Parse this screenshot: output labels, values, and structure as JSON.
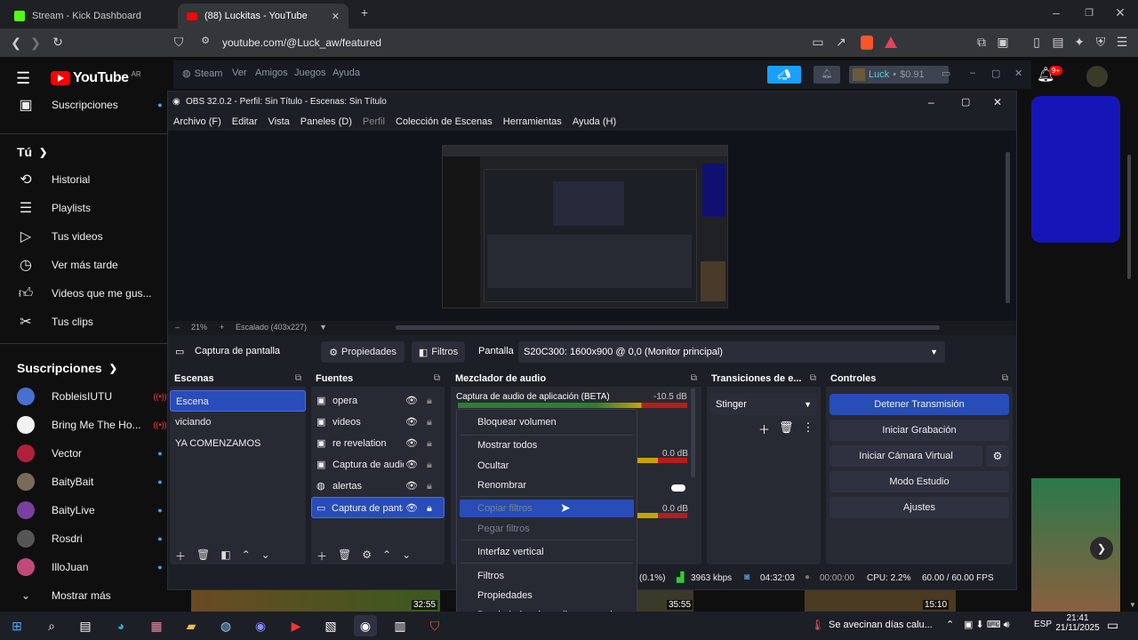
{
  "browser": {
    "tabs": [
      {
        "title": "Stream - Kick Dashboard"
      },
      {
        "title": "(88) Luckitas - YouTube"
      }
    ],
    "url": "youtube.com/@Luck_aw/featured"
  },
  "youtube": {
    "logo": "YouTube",
    "region": "AR",
    "subscriptions_label": "Suscripciones",
    "you_label": "Tú",
    "you_items": [
      "Historial",
      "Playlists",
      "Tus videos",
      "Ver más tarde",
      "Videos que me gus...",
      "Tus clips"
    ],
    "subs_header": "Suscripciones",
    "channels": [
      {
        "name": "RobleisIUTU",
        "live": true
      },
      {
        "name": "Bring Me The Ho...",
        "live": true
      },
      {
        "name": "Vector",
        "live": false
      },
      {
        "name": "BaityBait",
        "live": false
      },
      {
        "name": "BaityLive",
        "live": false
      },
      {
        "name": "Rosdri",
        "live": false
      },
      {
        "name": "IlloJuan",
        "live": false
      }
    ],
    "show_more": "Mostrar más",
    "notif_count": "9+"
  },
  "steam": {
    "brand": "Steam",
    "menu": [
      "Ver",
      "Amigos",
      "Juegos",
      "Ayuda"
    ],
    "user": "Luck",
    "balance": "$0.91"
  },
  "obs": {
    "title": "OBS 32.0.2 - Perfil: Sin Título - Escenas: Sin Título",
    "menu": [
      "Archivo (F)",
      "Editar",
      "Vista",
      "Paneles (D)",
      "Perfil",
      "Colección de Escenas",
      "Herramientas",
      "Ayuda (H)"
    ],
    "zoom": "21%",
    "scale": "Escalado (403x227)",
    "source_label": "Captura de pantalla",
    "props_btn": "Propiedades",
    "filters_btn": "Filtros",
    "display_label": "Pantalla",
    "display_value": "S20C300: 1600x900 @ 0,0 (Monitor principal)",
    "scenes_title": "Escenas",
    "scenes": [
      "Escena",
      "viciando",
      "YA COMENZAMOS"
    ],
    "sources_title": "Fuentes",
    "sources": [
      "opera",
      "videos",
      "re revelation",
      "Captura de audio",
      "alertas",
      "Captura de panta"
    ],
    "mixer_title": "Mezclador de audio",
    "mixer_channel": "Captura de audio de aplicación (BETA)",
    "mixer_db1": "-10.5 dB",
    "mixer_db2": "0.0 dB",
    "mixer_db3": "0.0 dB",
    "transitions_title": "Transiciones de e...",
    "transition_value": "Stinger",
    "controls_title": "Controles",
    "controls": [
      "Detener Transmisión",
      "Iniciar Grabación",
      "Iniciar Cámara Virtual",
      "Modo Estudio",
      "Ajustes"
    ],
    "status": {
      "drop": "(0.1%)",
      "kbps": "3963 kbps",
      "live_time": "04:32:03",
      "rec_time": "00:00:00",
      "cpu": "CPU: 2.2%",
      "fps": "60.00 / 60.00 FPS"
    }
  },
  "context_menu": {
    "items": [
      {
        "label": "Bloquear volumen",
        "disabled": false
      },
      {
        "label": "Mostrar todos",
        "disabled": false
      },
      {
        "label": "Ocultar",
        "disabled": false
      },
      {
        "label": "Renombrar",
        "disabled": false
      },
      {
        "label": "Copiar filtros",
        "disabled": true,
        "highlighted": true
      },
      {
        "label": "Pegar filtros",
        "disabled": true
      },
      {
        "label": "Interfaz vertical",
        "disabled": false
      },
      {
        "label": "Filtros",
        "disabled": false
      },
      {
        "label": "Propiedades",
        "disabled": false
      },
      {
        "label": "Propiedades de audio avanzadas",
        "disabled": false
      }
    ]
  },
  "video_times": [
    "32:55",
    "35:55",
    "15:10"
  ],
  "taskbar": {
    "weather": "Se avecinan días calu...",
    "lang": "ESP",
    "time": "21:41",
    "date": "21/11/2025"
  }
}
